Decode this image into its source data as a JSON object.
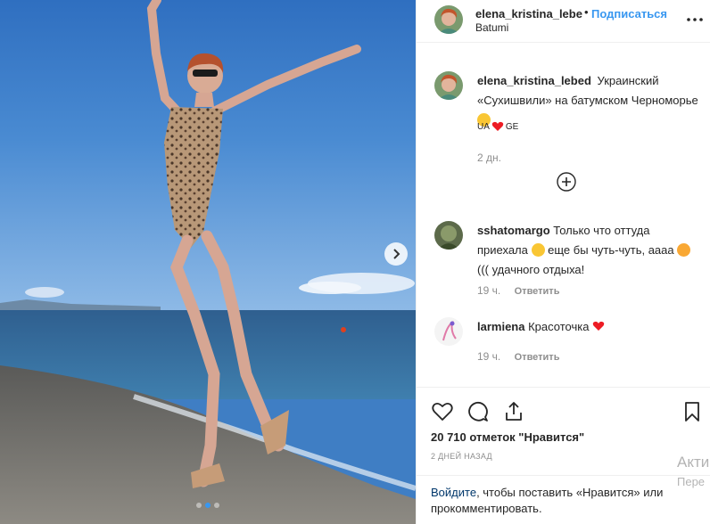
{
  "post": {
    "username": "elena_kristina_lebe",
    "separator": "•",
    "follow_label": "Подписаться",
    "location": "Batumi",
    "more_icon": "more-horizontal-icon"
  },
  "caption": {
    "username": "elena_kristina_lebed",
    "text": "Украинский «Сухишвили» на батумском Черноморье",
    "flags_left": "UA",
    "flags_right": "GE",
    "time": "2 дн."
  },
  "load_more_icon": "plus-circle-icon",
  "comments": [
    {
      "username": "sshatomargo",
      "text_part1": "Только что оттуда приехала",
      "text_part2": "еще бы чуть-чуть, аааа",
      "text_part3": "((( удачного отдыха!",
      "time": "19 ч.",
      "reply": "Ответить"
    },
    {
      "username": "larmiena",
      "text": "Красоточка",
      "time": "19 ч.",
      "reply": "Ответить"
    }
  ],
  "actions": {
    "like_icon": "heart-outline-icon",
    "comment_icon": "comment-icon",
    "share_icon": "share-icon",
    "save_icon": "bookmark-icon"
  },
  "likes": "20 710 отметок \"Нравится\"",
  "date": "2 ДНЕЙ НАЗАД",
  "login": {
    "link": "Войдите",
    "rest": ", чтобы поставить «Нравится» или прокомментировать."
  },
  "watermark": {
    "line1": "Акти",
    "line2": "Пере"
  },
  "carousel": {
    "current_index": 1,
    "total": 3
  },
  "colors": {
    "accent": "#3897f0",
    "heart_red": "#ed4956",
    "text": "#262626",
    "muted": "#8e8e8e"
  }
}
